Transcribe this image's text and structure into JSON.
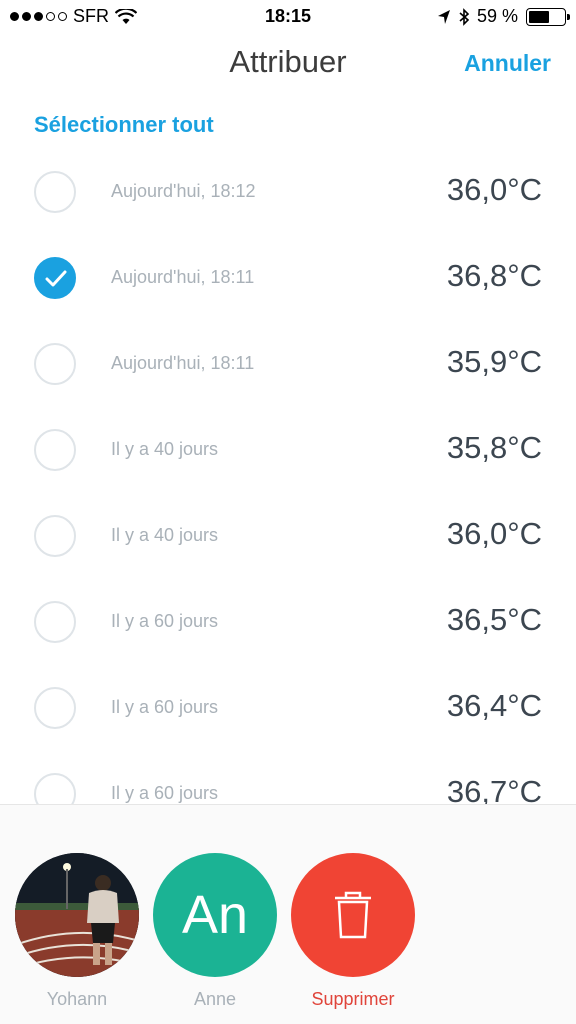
{
  "status_bar": {
    "carrier": "SFR",
    "time": "18:15",
    "battery": "59 %",
    "battery_level": 0.59
  },
  "nav": {
    "title": "Attribuer",
    "cancel_label": "Annuler"
  },
  "select_all_label": "Sélectionner tout",
  "measurements": [
    {
      "date": "Aujourd'hui, 18:12",
      "temperature": "36,0°C",
      "selected": false
    },
    {
      "date": "Aujourd'hui, 18:11",
      "temperature": "36,8°C",
      "selected": true
    },
    {
      "date": "Aujourd'hui, 18:11",
      "temperature": "35,9°C",
      "selected": false
    },
    {
      "date": "Il y a 40 jours",
      "temperature": "35,8°C",
      "selected": false
    },
    {
      "date": "Il y a 40 jours",
      "temperature": "36,0°C",
      "selected": false
    },
    {
      "date": "Il y a 60 jours",
      "temperature": "36,5°C",
      "selected": false
    },
    {
      "date": "Il y a 60 jours",
      "temperature": "36,4°C",
      "selected": false
    },
    {
      "date": "Il y a 60 jours",
      "temperature": "36,7°C",
      "selected": false
    }
  ],
  "profiles": [
    {
      "name": "Yohann",
      "type": "photo"
    },
    {
      "name": "Anne",
      "type": "initials",
      "initials": "An"
    },
    {
      "name": "Supprimer",
      "type": "delete"
    }
  ],
  "colors": {
    "accent": "#1aa1e0",
    "anne": "#1bb394",
    "delete": "#f04434"
  }
}
